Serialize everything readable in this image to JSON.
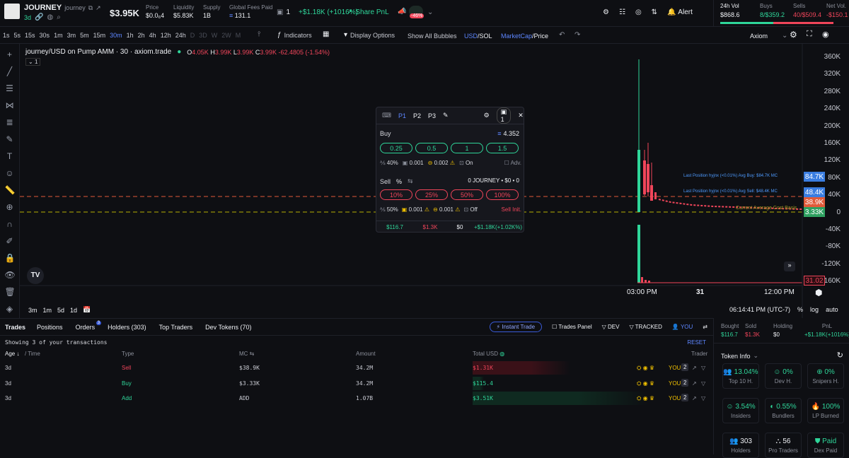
{
  "token": {
    "name": "JOURNEY",
    "ticker": "journey",
    "age": "3d",
    "price_mc": "$3.95K"
  },
  "stats": [
    {
      "label": "Price",
      "value": "$0.0₆4"
    },
    {
      "label": "Liquidity",
      "value": "$5.83K"
    },
    {
      "label": "Supply",
      "value": "1B"
    },
    {
      "label": "Global Fees Paid",
      "value": "131.1"
    }
  ],
  "top_right": {
    "count": "1",
    "pnl": "+$1.18K (+1016%)",
    "share": "Share PnL",
    "pct_badge": "-46%",
    "alert": "Alert",
    "vol_label": "24h Vol",
    "vol": "$868.6",
    "buys_label": "Buys",
    "buys": "8/$359.2",
    "sells_label": "Sells",
    "sells": "40/$509.4",
    "netvol_label": "Net Vol.",
    "netvol": "-$150.1"
  },
  "timeframes": [
    "1s",
    "5s",
    "15s",
    "30s",
    "1m",
    "3m",
    "5m",
    "15m",
    "30m",
    "1h",
    "2h",
    "4h",
    "12h",
    "24h",
    "D",
    "3D",
    "W",
    "2W",
    "M"
  ],
  "active_tf": "30m",
  "toolbar": {
    "indicators": "Indicators",
    "display": "Display Options",
    "bubbles": "Show All Bubbles",
    "usd": "USD",
    "sol": "/SOL",
    "mc": "MarketCap",
    "price": "/Price",
    "provider": "Axiom"
  },
  "chart": {
    "title": "journey/USD on Pump AMM · 30 · axiom.trade",
    "o": "4.05K",
    "h": "3.99K",
    "l": "3.99K",
    "c": "3.99K",
    "change": "-62.4805 (-1.54%)",
    "y_labels": [
      "360K",
      "320K",
      "280K",
      "240K",
      "200K",
      "160K",
      "120K",
      "80K",
      "40K",
      "0",
      "-40K",
      "-80K",
      "-120K",
      "-160K"
    ],
    "tags": [
      "84.7K",
      "48.4K",
      "38.9K",
      "3.33K",
      "31.02"
    ],
    "x_labels": [
      "03:00 PM",
      "31",
      "12:00 PM"
    ],
    "line1": "Last Position hyjnx (<0.01%) Avg Buy: $84.7K MC",
    "line2": "Last Position hyjnx (<0.01%) Avg Sell: $48.4K MC",
    "line3": "Current Average Cost Basis",
    "ranges": [
      "3m",
      "1m",
      "5d",
      "1d"
    ],
    "time": "06:14:41 PM (UTC-7)",
    "pct": "%",
    "log": "log",
    "auto": "auto",
    "layer": "1"
  },
  "panel": {
    "tabs": [
      "P1",
      "P2",
      "P3"
    ],
    "count": "1",
    "buy": "Buy",
    "sol_balance": "4.352",
    "buy_amounts": [
      "0.25",
      "0.5",
      "1",
      "1.5"
    ],
    "buy_slip": "40%",
    "buy_prio": "0.001",
    "buy_bribe": "0.002",
    "buy_mev": "On",
    "adv": "Adv.",
    "sell": "Sell",
    "sell_pct": "%",
    "holding": "0 JOURNEY • $0 • 0",
    "sell_amounts": [
      "10%",
      "25%",
      "50%",
      "100%"
    ],
    "sell_slip": "50%",
    "sell_prio": "0.001",
    "sell_bribe": "0.001",
    "sell_mev": "Off",
    "sell_init": "Sell Init.",
    "footer": [
      "$116.7",
      "$1.3K",
      "$0",
      "+$1.18K(+1.02K%)"
    ]
  },
  "tabs": [
    "Trades",
    "Positions",
    "Orders",
    "Holders (303)",
    "Top Traders",
    "Dev Tokens (70)"
  ],
  "orders_badge": "3",
  "filters": {
    "instant": "Instant Trade",
    "panel": "Trades Panel",
    "dev": "DEV",
    "tracked": "TRACKED",
    "you": "YOU",
    "reset": "RESET"
  },
  "showing": "Showing 3 of your transactions",
  "columns": [
    "Age",
    "/ Time",
    "Type",
    "MC",
    "Amount",
    "Total USD",
    "Trader"
  ],
  "trades": [
    {
      "age": "3d",
      "type": "Sell",
      "mc": "$38.9K",
      "amount": "34.2M",
      "total": "$1.31K",
      "trader": "YOU",
      "n": "2"
    },
    {
      "age": "3d",
      "type": "Buy",
      "mc": "$3.33K",
      "amount": "34.2M",
      "total": "$115.4",
      "trader": "YOU",
      "n": "2"
    },
    {
      "age": "3d",
      "type": "Add",
      "mc": "ADD",
      "amount": "1.07B",
      "total": "$3.51K",
      "trader": "YOU",
      "n": "2"
    }
  ],
  "summary": [
    {
      "l": "Bought",
      "v": "$116.7"
    },
    {
      "l": "Sold",
      "v": "$1.3K"
    },
    {
      "l": "Holding",
      "v": "$0"
    },
    {
      "l": "PnL",
      "v": "+$1.18K(+1016%)"
    }
  ],
  "token_info": {
    "title": "Token Info",
    "cards": [
      {
        "v": "13.04%",
        "l": "Top 10 H."
      },
      {
        "v": "0%",
        "l": "Dev H."
      },
      {
        "v": "0%",
        "l": "Snipers H."
      },
      {
        "v": "3.54%",
        "l": "Insiders"
      },
      {
        "v": "0.55%",
        "l": "Bundlers"
      },
      {
        "v": "100%",
        "l": "LP Burned"
      },
      {
        "v": "303",
        "l": "Holders"
      },
      {
        "v": "56",
        "l": "Pro Traders"
      },
      {
        "v": "Paid",
        "l": "Dex Paid"
      }
    ]
  }
}
